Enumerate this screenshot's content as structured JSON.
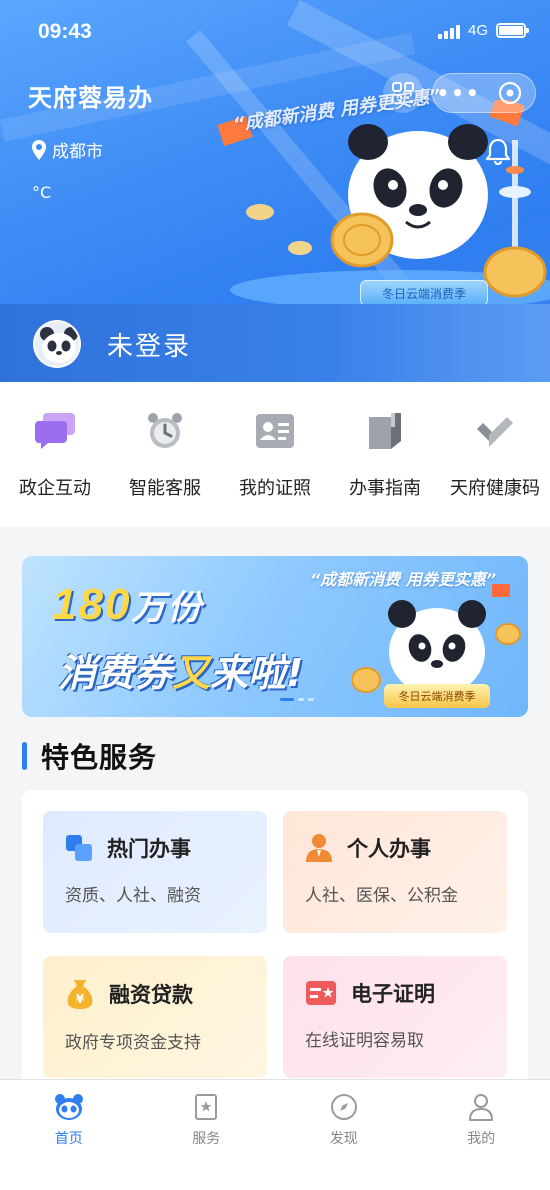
{
  "status_bar": {
    "time": "09:43",
    "network": "4G"
  },
  "header": {
    "app_title": "天府蓉易办",
    "location": "成都市",
    "temperature": "°C",
    "banner_slogan": "“成都新消费 用券更实惠”",
    "season_tag": "冬日云端消费季"
  },
  "user": {
    "login_status": "未登录"
  },
  "quick_entries": [
    {
      "label": "政企互动",
      "icon": "chat-bubbles-icon"
    },
    {
      "label": "智能客服",
      "icon": "alarm-clock-icon"
    },
    {
      "label": "我的证照",
      "icon": "id-card-icon"
    },
    {
      "label": "办事指南",
      "icon": "guide-book-icon"
    },
    {
      "label": "天府健康码",
      "icon": "health-code-icon"
    }
  ],
  "promo_banner": {
    "slogan": "“成都新消费 用券更实惠”",
    "big_number": "180",
    "big_unit": "万份",
    "headline_a": "消费券",
    "headline_b": "又",
    "headline_c": "来啦!",
    "tag": "冬日云端消费季"
  },
  "section": {
    "title": "特色服务"
  },
  "services": [
    {
      "title": "热门办事",
      "desc": "资质、人社、融资",
      "icon": "hot-affairs-icon",
      "color": "#2f7ef0"
    },
    {
      "title": "个人办事",
      "desc": "人社、医保、公积金",
      "icon": "person-icon",
      "color": "#f08a35"
    },
    {
      "title": "融资贷款",
      "desc": "政府专项资金支持",
      "icon": "money-bag-icon",
      "color": "#f4b32c"
    },
    {
      "title": "电子证明",
      "desc": "在线证明容易取",
      "icon": "certificate-icon",
      "color": "#ef5a5a"
    }
  ],
  "tabs": [
    {
      "label": "首页",
      "icon": "panda-home-icon",
      "active": true
    },
    {
      "label": "服务",
      "icon": "star-bookmark-icon",
      "active": false
    },
    {
      "label": "发现",
      "icon": "compass-icon",
      "active": false
    },
    {
      "label": "我的",
      "icon": "user-icon",
      "active": false
    }
  ],
  "colors": {
    "primary": "#2f7ef0",
    "inactive_tab": "#888888"
  }
}
